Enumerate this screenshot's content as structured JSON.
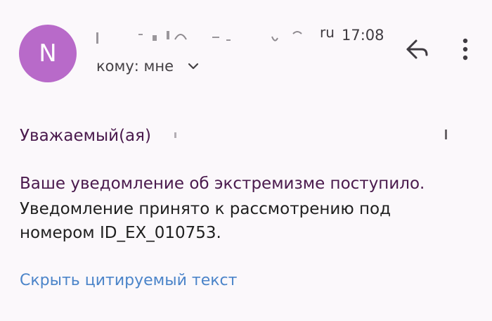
{
  "email": {
    "avatar_letter": "N",
    "avatar_color": "#b86ac9",
    "sender_partial": "ru",
    "time": "17:08",
    "recipient": "кому: мне"
  },
  "icons": {
    "reply": "reply-arrow-icon",
    "more": "more-vertical-icon",
    "chevron": "chevron-down-icon"
  },
  "message": {
    "greeting": "Уважаемый(ая)",
    "line1": "Ваше уведомление об экстремизме поступило.",
    "line2": "Уведомление принято к рассмотрению под",
    "line3": "номером ID_EX_010753."
  },
  "actions": {
    "hide_quoted": "Скрыть цитируемый текст"
  },
  "colors": {
    "background": "#fbf8fb",
    "accent_text": "#4a1a4d",
    "link": "#4b84c9"
  }
}
